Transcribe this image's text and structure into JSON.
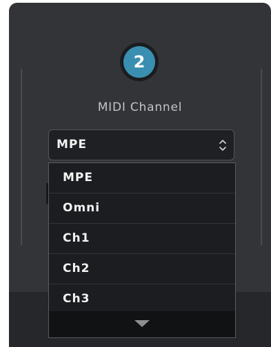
{
  "step": {
    "number": "2"
  },
  "midi": {
    "label": "MIDI Channel",
    "selected": "MPE",
    "options": [
      "MPE",
      "Omni",
      "Ch1",
      "Ch2",
      "Ch3"
    ]
  },
  "icons": {
    "select_toggle": "up-down-chevron-icon",
    "scroll_more": "caret-down-icon"
  },
  "colors": {
    "panel": "#333438",
    "accent": "#3a8fb1",
    "dropdown": "#1c1d20"
  }
}
